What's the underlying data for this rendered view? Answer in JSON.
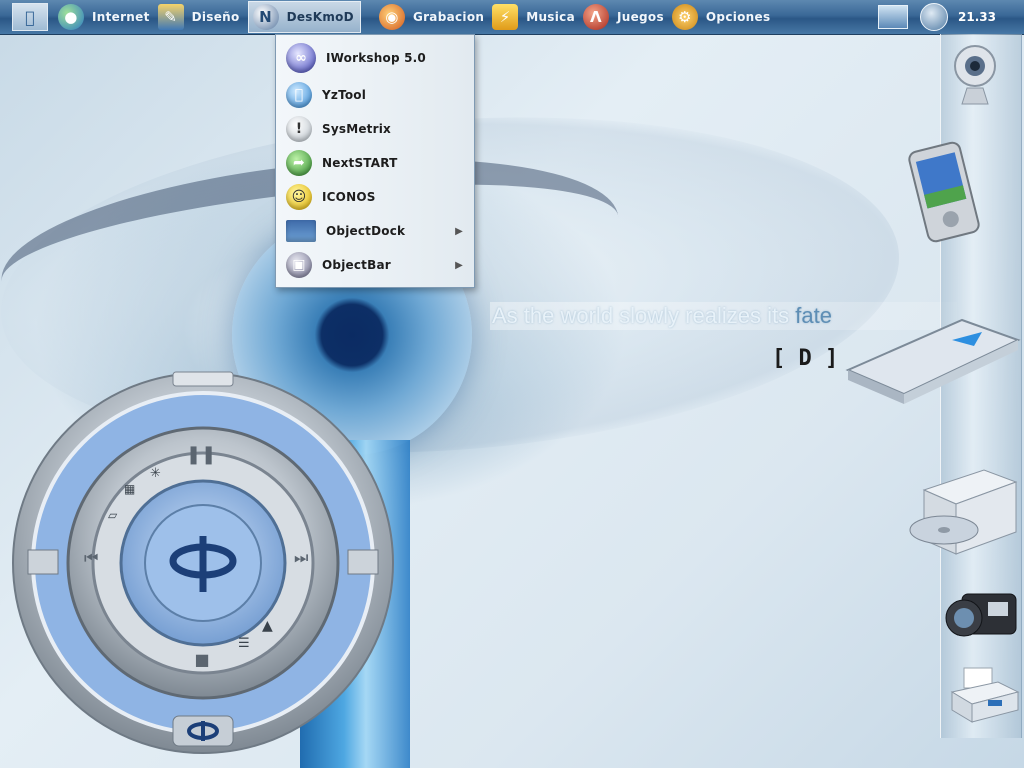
{
  "taskbar": {
    "items": [
      {
        "label": "Internet",
        "icon": "globe-icon",
        "active": false
      },
      {
        "label": "Diseño",
        "icon": "design-icon",
        "active": false
      },
      {
        "label": "DesKmoD",
        "icon": "deskmod-icon",
        "active": true
      },
      {
        "label": "Grabacion",
        "icon": "burn-icon",
        "active": false
      },
      {
        "label": "Musica",
        "icon": "music-icon",
        "active": false
      },
      {
        "label": "Juegos",
        "icon": "games-icon",
        "active": false
      },
      {
        "label": "Opciones",
        "icon": "gear-icon",
        "active": false
      }
    ],
    "clock": "21.33"
  },
  "menu": {
    "items": [
      {
        "label": "IWorkshop 5.0",
        "icon": "iworkshop-icon",
        "submenu": false
      },
      {
        "label": "YzTool",
        "icon": "apple-icon",
        "submenu": false
      },
      {
        "label": "SysMetrix",
        "icon": "exclamation-icon",
        "submenu": false
      },
      {
        "label": "NextSTART",
        "icon": "nextstart-icon",
        "submenu": false
      },
      {
        "label": "ICONOS",
        "icon": "smiley-icon",
        "submenu": false
      },
      {
        "label": "ObjectDock",
        "icon": "objectdock-icon",
        "submenu": true
      },
      {
        "label": "ObjectBar",
        "icon": "objectbar-icon",
        "submenu": true
      }
    ]
  },
  "wallpaper": {
    "caption_main": "As the world slowly realizes its",
    "caption_accent": "fate",
    "logo": "[ D ]"
  },
  "dock": {
    "items": [
      "webcam-icon",
      "pda-icon",
      "scanner-icon",
      "optical-drive-icon",
      "camcorder-icon",
      "fax-icon"
    ]
  },
  "colors": {
    "accent": "#3a6897",
    "player_ring": "#8fb4e4"
  }
}
